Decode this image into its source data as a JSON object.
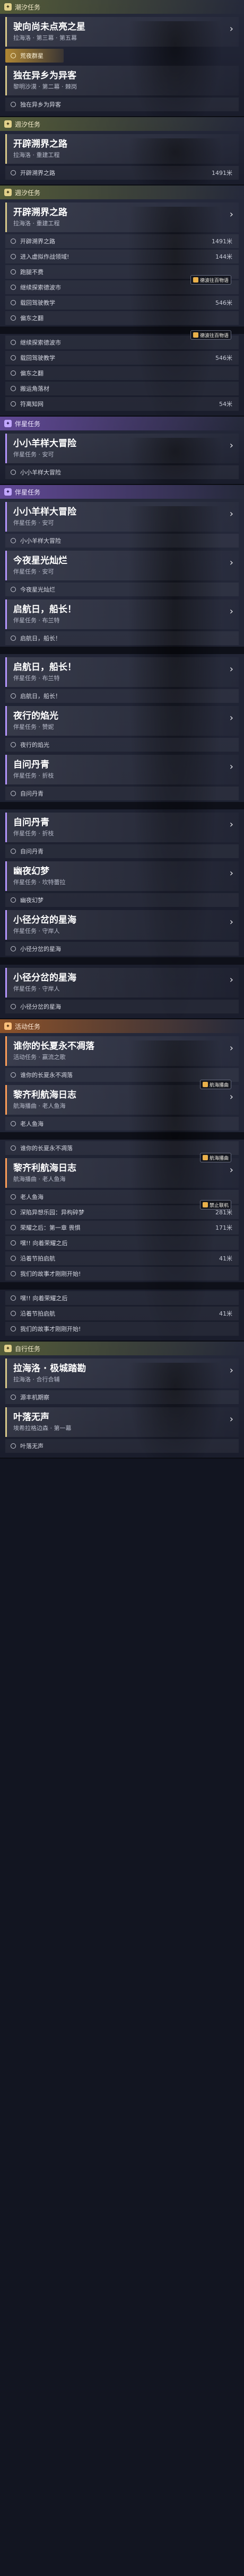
{
  "panels": [
    {
      "header": "潮汐任务",
      "color": "gold",
      "icon": "tide-quest-icon",
      "blocks": [
        {
          "type": "quest",
          "title": "驶向尚未点亮之星",
          "sub": "拉海洛 · 第三幕 · 第五幕"
        },
        {
          "type": "hl",
          "text": "荒夜群星"
        },
        {
          "type": "quest",
          "title": "独在异乡为异客",
          "sub": "黎明沙漠 · 第二幕 · 棘岗",
          "noarrow": true
        },
        {
          "type": "obj",
          "text": "独在异乡为异客"
        }
      ]
    },
    {
      "header": "週汐任务",
      "color": "gold",
      "icon": "tide-quest-icon",
      "blocks": [
        {
          "type": "quest",
          "title": "开辟溯界之路",
          "sub": "拉海洛 · 重建工程",
          "noarrow": true
        },
        {
          "type": "obj",
          "text": "开辟溯界之路",
          "dist": "1491米"
        }
      ]
    },
    {
      "header": "週汐任务",
      "color": "gold",
      "icon": "tide-quest-icon",
      "blocks": [
        {
          "type": "quest",
          "title": "开辟溯界之路",
          "sub": "拉海洛 · 重建工程"
        },
        {
          "type": "obj",
          "text": "开辟溯界之路",
          "dist": "1491米"
        },
        {
          "type": "obj",
          "text": "进入虚拟作战领域!",
          "dist": "144米"
        },
        {
          "type": "obj",
          "text": "跑腿不费"
        },
        {
          "type": "obj",
          "text": "继续探索德波市"
        },
        {
          "type": "obj",
          "text": "载回驾驶教学",
          "dist": "546米"
        },
        {
          "type": "obj",
          "text": "偏东之翻"
        },
        {
          "type": "gap"
        },
        {
          "type": "obj",
          "text": "继续探索德波市"
        },
        {
          "type": "obj",
          "text": "载回驾驶教学",
          "dist": "546米"
        },
        {
          "type": "obj",
          "text": "偏东之翻"
        },
        {
          "type": "obj",
          "text": "搬运角落材"
        },
        {
          "type": "obj",
          "text": "符离知网",
          "dist": "54米"
        }
      ],
      "badges": [
        {
          "text": "德波往百物语",
          "block": 4
        },
        {
          "text": "德波往百物语",
          "block": 8
        }
      ]
    },
    {
      "header": "伴星任务",
      "color": "purple",
      "icon": "companion-quest-icon",
      "blocks": [
        {
          "type": "quest",
          "title": "小小羊样大冒险",
          "sub": "伴星任务 · 安可"
        },
        {
          "type": "obj",
          "text": "小小羊样大冒险"
        }
      ]
    },
    {
      "header": "伴星任务",
      "color": "purple",
      "icon": "companion-quest-icon",
      "blocks": [
        {
          "type": "quest",
          "title": "小小羊样大冒险",
          "sub": "伴星任务 · 安可"
        },
        {
          "type": "obj",
          "text": "小小羊样大冒险"
        },
        {
          "type": "quest",
          "title": "今夜星光灿烂",
          "sub": "伴星任务 · 安可"
        },
        {
          "type": "obj",
          "text": "今夜星光灿烂"
        },
        {
          "type": "quest",
          "title": "启航日，船长！",
          "sub": "伴星任务 · 布兰特"
        },
        {
          "type": "obj",
          "text": "启航日，船长！"
        },
        {
          "type": "gap"
        },
        {
          "type": "quest",
          "title": "启航日，船长！",
          "sub": "伴星任务 · 布兰特"
        },
        {
          "type": "obj",
          "text": "启航日，船长！"
        },
        {
          "type": "quest",
          "title": "夜行的焰光",
          "sub": "伴星任务 · 赞妮"
        },
        {
          "type": "obj",
          "text": "夜行的焰光"
        },
        {
          "type": "quest",
          "title": "自问丹青",
          "sub": "伴星任务 · 折枝"
        },
        {
          "type": "obj",
          "text": "自问丹青"
        },
        {
          "type": "gap"
        },
        {
          "type": "quest",
          "title": "自问丹青",
          "sub": "伴星任务 · 折枝"
        },
        {
          "type": "obj",
          "text": "自问丹青"
        },
        {
          "type": "quest",
          "title": "幽夜幻梦",
          "sub": "伴星任务 · 坎特蕾拉"
        },
        {
          "type": "obj",
          "text": "幽夜幻梦"
        },
        {
          "type": "quest",
          "title": "小径分岔的星海",
          "sub": "伴星任务 · 守岸人"
        },
        {
          "type": "obj",
          "text": "小径分岔的星海"
        },
        {
          "type": "gap"
        },
        {
          "type": "quest",
          "title": "小径分岔的星海",
          "sub": "伴星任务 · 守岸人"
        },
        {
          "type": "obj",
          "text": "小径分岔的星海"
        }
      ]
    },
    {
      "header": "活动任务",
      "color": "orange",
      "icon": "event-quest-icon",
      "blocks": [
        {
          "type": "quest",
          "title": "谁你的长夏永不凋落",
          "sub": "活动任务 · 赢流之歌"
        },
        {
          "type": "obj",
          "text": "谁你的长夏永不凋落"
        },
        {
          "type": "quest",
          "title": "黎齐利航海日志",
          "sub": "航海播曲 · 老人鱼海"
        },
        {
          "type": "obj",
          "text": "老人鱼海"
        },
        {
          "type": "gap"
        },
        {
          "type": "obj",
          "text": "谁你的长夏永不凋落"
        },
        {
          "type": "quest",
          "title": "黎齐利航海日志",
          "sub": "航海播曲 · 老人鱼海"
        },
        {
          "type": "obj",
          "text": "老人鱼海"
        },
        {
          "type": "obj",
          "text": "深陷异想乐园：异构碎梦",
          "dist": "281米"
        },
        {
          "type": "obj",
          "text": "荣耀之后：第一章 畏惧",
          "dist": "171米"
        },
        {
          "type": "obj",
          "text": "嘿!! 向着荣耀之后"
        },
        {
          "type": "obj",
          "text": "沿着节拍启航",
          "dist": "41米"
        },
        {
          "type": "obj",
          "text": "我们的故事才刚刚开始!"
        },
        {
          "type": "gap"
        },
        {
          "type": "obj",
          "text": "嘿!! 向着荣耀之后"
        },
        {
          "type": "obj",
          "text": "沿着节拍启航",
          "dist": "41米"
        },
        {
          "type": "obj",
          "text": "我们的故事才刚刚开始!"
        }
      ],
      "badges": [
        {
          "text": "航海播曲",
          "block": 2
        },
        {
          "text": "航海播曲",
          "block": 6
        },
        {
          "text": "禁止联机",
          "block": 8
        }
      ]
    },
    {
      "header": "自行任务",
      "color": "gold",
      "icon": "self-quest-icon",
      "blocks": [
        {
          "type": "quest",
          "title": "拉海洛 · 极城踏勘",
          "sub": "拉海洛 · 合行合辅"
        },
        {
          "type": "obj",
          "text": "源丰机期察"
        },
        {
          "type": "quest",
          "title": "叶落无声",
          "sub": "埃希拉格边森 · 第一幕"
        },
        {
          "type": "obj",
          "text": "叶落无声"
        }
      ]
    }
  ]
}
